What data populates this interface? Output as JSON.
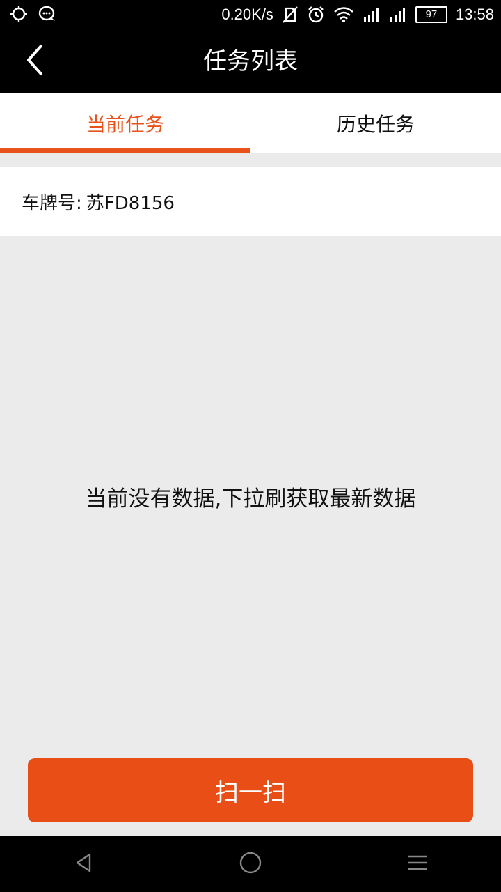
{
  "status_bar": {
    "network_speed": "0.20K/s",
    "battery": "97",
    "time": "13:58",
    "icons": [
      "location-icon",
      "chat-bubble-icon",
      "no-sim-icon",
      "alarm-icon",
      "wifi-icon",
      "signal-icon",
      "signal-2-icon"
    ]
  },
  "header": {
    "title": "任务列表",
    "back_icon": "chevron-left-icon"
  },
  "tabs": [
    {
      "label": "当前任务",
      "active": true
    },
    {
      "label": "历史任务",
      "active": false
    }
  ],
  "plate": {
    "label": "车牌号:",
    "value": "苏FD8156"
  },
  "empty_message": "当前没有数据,下拉刷获取最新数据",
  "scan_button": {
    "label": "扫一扫"
  },
  "nav_bar": {
    "icons": [
      "back-triangle-icon",
      "home-circle-icon",
      "menu-lines-icon"
    ]
  },
  "colors": {
    "accent": "#e8531c",
    "button": "#e84e15",
    "background": "#ebebeb",
    "header": "#000000"
  }
}
